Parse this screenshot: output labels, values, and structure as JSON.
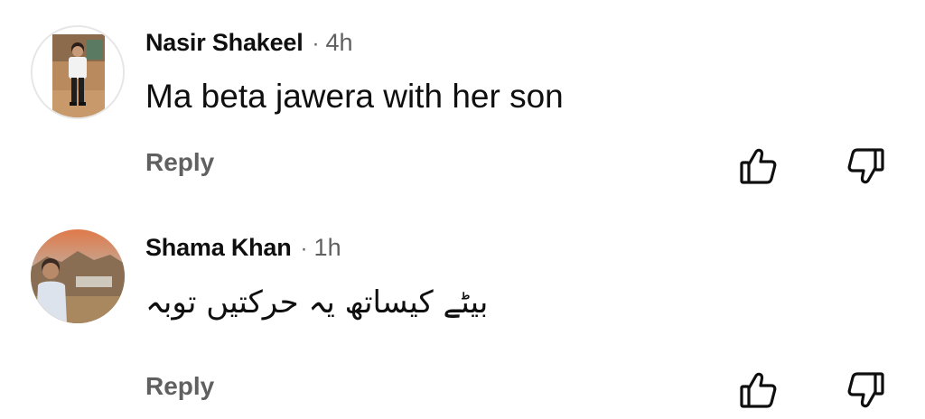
{
  "comments": [
    {
      "author": "Nasir Shakeel",
      "separator": "·",
      "time": "4h",
      "text": "Ma beta jawera with her son",
      "reply_label": "Reply"
    },
    {
      "author": "Shama Khan",
      "separator": "·",
      "time": "1h",
      "text": "بیٹے کیساتھ یہ حرکتیں  توبہ",
      "reply_label": "Reply"
    }
  ],
  "icons": {
    "like": "thumbs-up-icon",
    "dislike": "thumbs-down-icon"
  },
  "colors": {
    "author_text": "#0f0f0f",
    "meta_text": "#606060",
    "background": "#ffffff"
  }
}
